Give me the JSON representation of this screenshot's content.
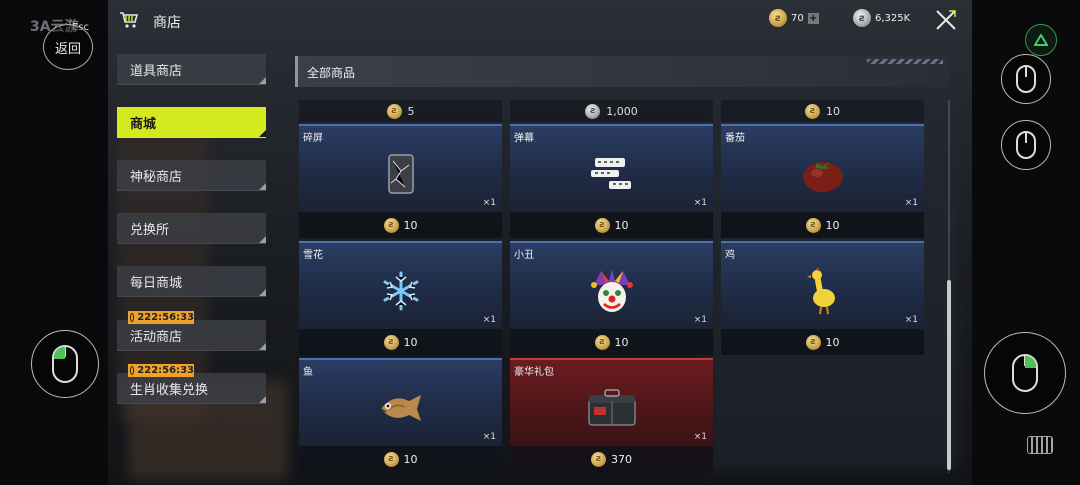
{
  "window": {
    "logo": "3A云游",
    "esc_label": "Esc",
    "back_label": "返回"
  },
  "header": {
    "title": "商店",
    "gold_amount": "70",
    "silver_amount": "6,325K"
  },
  "menu": [
    {
      "label": "道具商店",
      "active": false
    },
    {
      "label": "商城",
      "active": true
    },
    {
      "label": "神秘商店",
      "active": false
    },
    {
      "label": "兑换所",
      "active": false
    },
    {
      "label": "每日商城",
      "active": false
    },
    {
      "label": "活动商店",
      "active": false,
      "timer": "222:56:33"
    },
    {
      "label": "生肖收集兑换",
      "active": false,
      "timer": "222:56:33"
    }
  ],
  "panel": {
    "title": "全部商品"
  },
  "top_prices": [
    {
      "currency": "gold",
      "value": "5"
    },
    {
      "currency": "silver",
      "value": "1,000"
    },
    {
      "currency": "gold",
      "value": "10"
    }
  ],
  "items": [
    {
      "name": "碎屏",
      "qty": "×1",
      "currency": "gold",
      "price": "10",
      "icon": "cracked-screen-icon"
    },
    {
      "name": "弹幕",
      "qty": "×1",
      "currency": "gold",
      "price": "10",
      "icon": "bullet-comments-icon"
    },
    {
      "name": "番茄",
      "qty": "×1",
      "currency": "gold",
      "price": "10",
      "icon": "tomato-icon"
    },
    {
      "name": "雪花",
      "qty": "×1",
      "currency": "gold",
      "price": "10",
      "icon": "snowflake-icon"
    },
    {
      "name": "小丑",
      "qty": "×1",
      "currency": "gold",
      "price": "10",
      "icon": "clown-icon"
    },
    {
      "name": "鸡",
      "qty": "×1",
      "currency": "gold",
      "price": "10",
      "icon": "chicken-icon"
    },
    {
      "name": "鱼",
      "qty": "×1",
      "currency": "gold",
      "price": "10",
      "icon": "fish-icon"
    },
    {
      "name": "豪华礼包",
      "qty": "×1",
      "currency": "gold",
      "price": "370",
      "icon": "gift-box-icon",
      "highlight": "red"
    }
  ],
  "colors": {
    "accent": "#d4ea1e",
    "timer": "#f0a12a",
    "card_blue": "#4c6fb0",
    "card_red": "#c23a3a"
  }
}
